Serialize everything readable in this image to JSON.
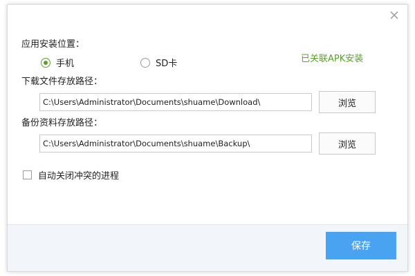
{
  "install_location": {
    "label": "应用安装位置：",
    "options": [
      {
        "label": "手机",
        "selected": true
      },
      {
        "label": "SD卡",
        "selected": false
      }
    ],
    "status_text": "已关联APK安装"
  },
  "download_path": {
    "label": "下载文件存放路径：",
    "value": "C:\\Users\\Administrator\\Documents\\shuame\\Download\\",
    "browse_label": "浏览"
  },
  "backup_path": {
    "label": "备份资料存放路径：",
    "value": "C:\\Users\\Administrator\\Documents\\shuame\\Backup\\",
    "browse_label": "浏览"
  },
  "auto_close": {
    "label": "自动关闭冲突的进程",
    "checked": false
  },
  "footer": {
    "save_label": "保存"
  },
  "colors": {
    "accent_green": "#5aa02c",
    "save_blue": "#4aa3f0",
    "footer_bg": "#f2f5f9"
  },
  "icons": {
    "close": "close-icon"
  }
}
